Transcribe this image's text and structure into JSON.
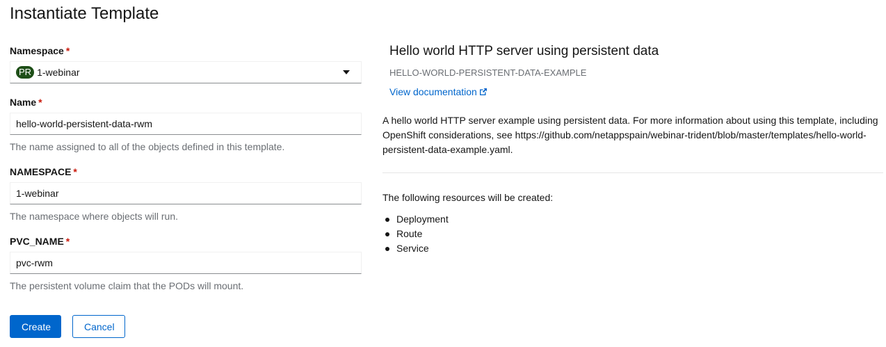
{
  "page": {
    "title": "Instantiate Template"
  },
  "form": {
    "namespace": {
      "label": "Namespace",
      "required_mark": "*",
      "badge": "PR",
      "value": "1-webinar",
      "icon": "caret-down-icon"
    },
    "name": {
      "label": "Name",
      "required_mark": "*",
      "value": "hello-world-persistent-data-rwm",
      "helper": "The name assigned to all of the objects defined in this template."
    },
    "namespace_param": {
      "label": "NAMESPACE",
      "required_mark": "*",
      "value": "1-webinar",
      "helper": "The namespace where objects will run."
    },
    "pvc_name": {
      "label": "PVC_NAME",
      "required_mark": "*",
      "value": "pvc-rwm",
      "helper": "The persistent volume claim that the PODs will mount."
    }
  },
  "buttons": {
    "create": "Create",
    "cancel": "Cancel"
  },
  "template": {
    "title": "Hello world HTTP server using persistent data",
    "id": "HELLO-WORLD-PERSISTENT-DATA-EXAMPLE",
    "doc_link": "View documentation",
    "doc_icon": "external-link-icon",
    "description": "A hello world HTTP server example using persistent data. For more information about using this template, including OpenShift considerations, see https://github.com/netappspain/webinar-trident/blob/master/templates/hello-world-persistent-data-example.yaml.",
    "resources_heading": "The following resources will be created:",
    "resources": [
      "Deployment",
      "Route",
      "Service"
    ]
  },
  "colors": {
    "primary": "#0066cc",
    "required": "#c9190b",
    "badge": "#1e4f18",
    "helper_text": "#6a6e73"
  }
}
